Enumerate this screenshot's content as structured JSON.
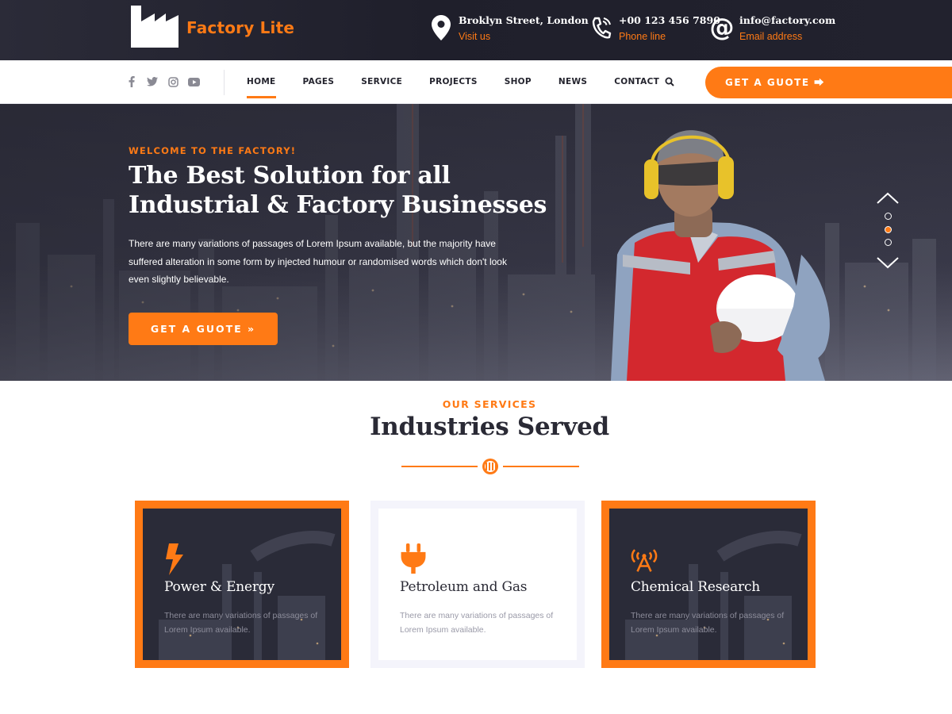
{
  "brand": {
    "name": "Factory Lite"
  },
  "topbar": {
    "contacts": [
      {
        "icon": "map-pin-icon",
        "main": "Broklyn Street, London",
        "sub": "Visit us"
      },
      {
        "icon": "phone-icon",
        "main": "+00 123 456 7890",
        "sub": "Phone line"
      },
      {
        "icon": "at-sign-icon",
        "main": "info@factory.com",
        "sub": "Email address"
      }
    ]
  },
  "nav": {
    "social": [
      "facebook-icon",
      "twitter-icon",
      "instagram-icon",
      "youtube-icon"
    ],
    "items": [
      "HOME",
      "PAGES",
      "SERVICE",
      "PROJECTS",
      "SHOP",
      "NEWS",
      "CONTACT"
    ],
    "active": "HOME",
    "quote_label": "GET A GUOTE ⮕"
  },
  "hero": {
    "eyebrow": "WELCOME TO THE FACTORY!",
    "title": "The Best Solution for all Industrial & Factory Businesses",
    "body": "There are many variations of passages of Lorem Ipsum available, but the majority have suffered alteration in some form by injected humour or randomised words which don't look even slightly believable.",
    "button_label": "GET A GUOTE »",
    "slides": {
      "count": 3,
      "active_index": 2
    }
  },
  "services": {
    "eyebrow": "OUR SERVICES",
    "title": "Industries Served",
    "cards": [
      {
        "icon": "lightning-bolt-icon",
        "title": "Power & Energy",
        "desc": "There are many variations of passages of Lorem Ipsum available.",
        "style": "dark"
      },
      {
        "icon": "plug-icon",
        "title": "Petroleum and Gas",
        "desc": "There are many variations of passages of Lorem Ipsum available.",
        "style": "light"
      },
      {
        "icon": "antenna-tower-icon",
        "title": "Chemical Research",
        "desc": "There are many variations of passages of Lorem Ipsum available.",
        "style": "dark"
      }
    ]
  },
  "colors": {
    "accent": "#ff7a15",
    "dark": "#24242e",
    "topbar": "#22222e"
  }
}
